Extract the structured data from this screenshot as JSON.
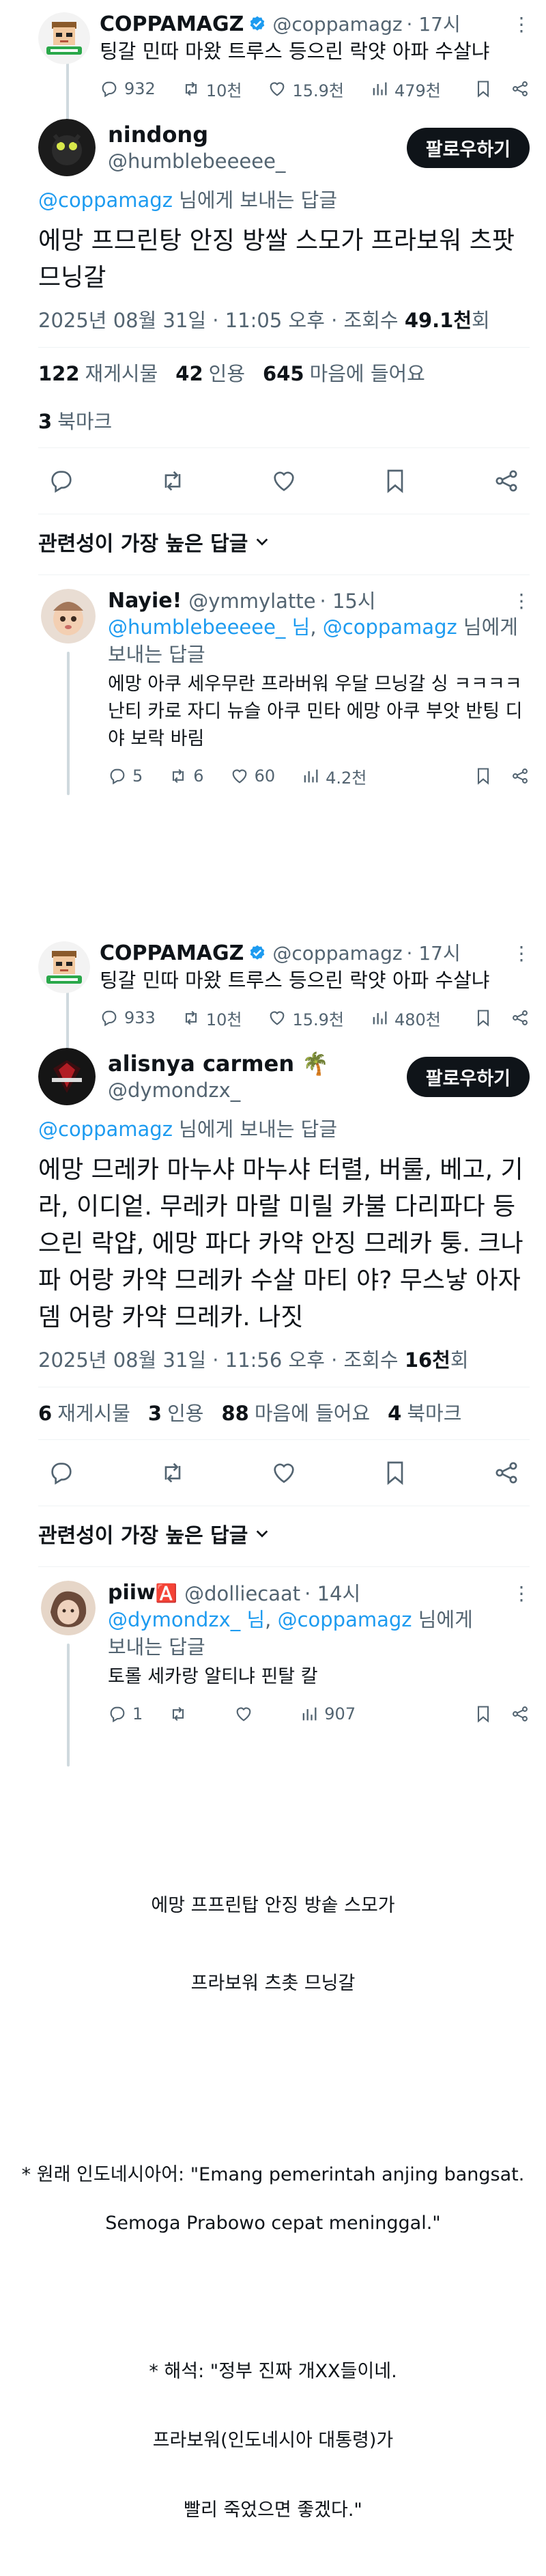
{
  "thread1": {
    "parent": {
      "name": "COPPAMAGZ",
      "handle": "@coppamagz",
      "time": "· 17시",
      "text": "팅갈 민따 마왔 트루스 등으린 락얏 아파 수살냐",
      "replies": "932",
      "reposts": "10천",
      "likes": "15.9천",
      "views": "479천"
    },
    "main": {
      "name": "nindong",
      "handle": "@humblebeeeee_",
      "follow": "팔로우하기",
      "reply_to_handle": "@coppamagz",
      "reply_to_suffix": " 님에게 보내는 답글",
      "text": "에망 프므린탕 안징 방쌀 스모가 프라보워 츠팟 므닝갈",
      "meta_prefix": "2025년 08월 31일 · 11:05 오후 · 조회수 ",
      "views": "49.1천",
      "views_suffix": "회",
      "stats": [
        {
          "num": "122",
          "label": "재게시물"
        },
        {
          "num": "42",
          "label": "인용"
        },
        {
          "num": "645",
          "label": "마음에 들어요"
        },
        {
          "num": "3",
          "label": "북마크"
        }
      ]
    },
    "relevance": "관련성이 가장 높은 답글",
    "reply": {
      "name": "Nayie!",
      "handle": "@ymmylatte",
      "time": "· 15시",
      "mention1": "@humblebeeeee_ 님",
      "comma": ", ",
      "mention2": "@coppamagz",
      "mention_suffix": " 님에게",
      "reply_label": "보내는 답글",
      "text": "에망 아쿠 세우무란 프라버워 우달 므닝갈 싱 ㅋㅋㅋㅋ 난티 카로 자디 뉴슬 아쿠 민타 에망 아쿠 부앗 반팅 디야 보락 바림",
      "replies": "5",
      "reposts": "6",
      "likes": "60",
      "views": "4.2천"
    }
  },
  "thread2": {
    "parent": {
      "name": "COPPAMAGZ",
      "handle": "@coppamagz",
      "time": "· 17시",
      "text": "팅갈 민따 마왔 트루스 등으린 락얏 아파 수살냐",
      "replies": "933",
      "reposts": "10천",
      "likes": "15.9천",
      "views": "480천"
    },
    "main": {
      "name": "alisnya carmen",
      "emoji": "🌴",
      "handle": "@dymondzx_",
      "follow": "팔로우하기",
      "reply_to_handle": "@coppamagz",
      "reply_to_suffix": " 님에게 보내는 답글",
      "text": "에망 므레카 마누샤 마누샤 터렬, 버룰, 베고, 기라, 이디엍. 무레카 마랄 미릴 카불 다리파다 등으린 락얍, 에망 파다 카약 안징 므레카 퉁. 크나파 어랑 카약 므레카 수살 마티 야? 무스낳 아자 뎀 어랑 카약 므레카. 나짓",
      "meta_prefix": "2025년 08월 31일 · 11:56 오후 · 조회수 ",
      "views": "16천",
      "views_suffix": "회",
      "stats": [
        {
          "num": "6",
          "label": "재게시물"
        },
        {
          "num": "3",
          "label": "인용"
        },
        {
          "num": "88",
          "label": "마음에 들어요"
        },
        {
          "num": "4",
          "label": "북마크"
        }
      ]
    },
    "relevance": "관련성이 가장 높은 답글",
    "reply": {
      "name": "piiw",
      "badge": "🅰️",
      "handle": "@dolliecaat",
      "time": "· 14시",
      "mention1": "@dymondzx_ 님",
      "comma": ", ",
      "mention2": "@coppamagz",
      "mention_suffix": " 님에게",
      "reply_label": "보내는 답글",
      "text": "토롤 세카랑 알티냐 핀탈 칼",
      "replies": "1",
      "views": "907"
    }
  },
  "notes": {
    "line1": "에망 프프린탑 안징 방솥 스모가",
    "line2": "프라보워 츠촛 므닝갈",
    "orig1": "* 원래 인도네시아어: \"Emang pemerintah anjing bangsat.",
    "orig2": "Semoga Prabowo cepat meninggal.\"",
    "trans1": "* 해석: \"정부 진짜 개XX들이네.",
    "trans2": "프라보워(인도네시아 대통령)가",
    "trans3": "빨리 죽었으면 좋겠다.\""
  },
  "colors": {
    "text": "#0f1419",
    "muted": "#536471",
    "link": "#1d9bf0",
    "verified": "#1d9bf0",
    "button": "#0f1419"
  }
}
